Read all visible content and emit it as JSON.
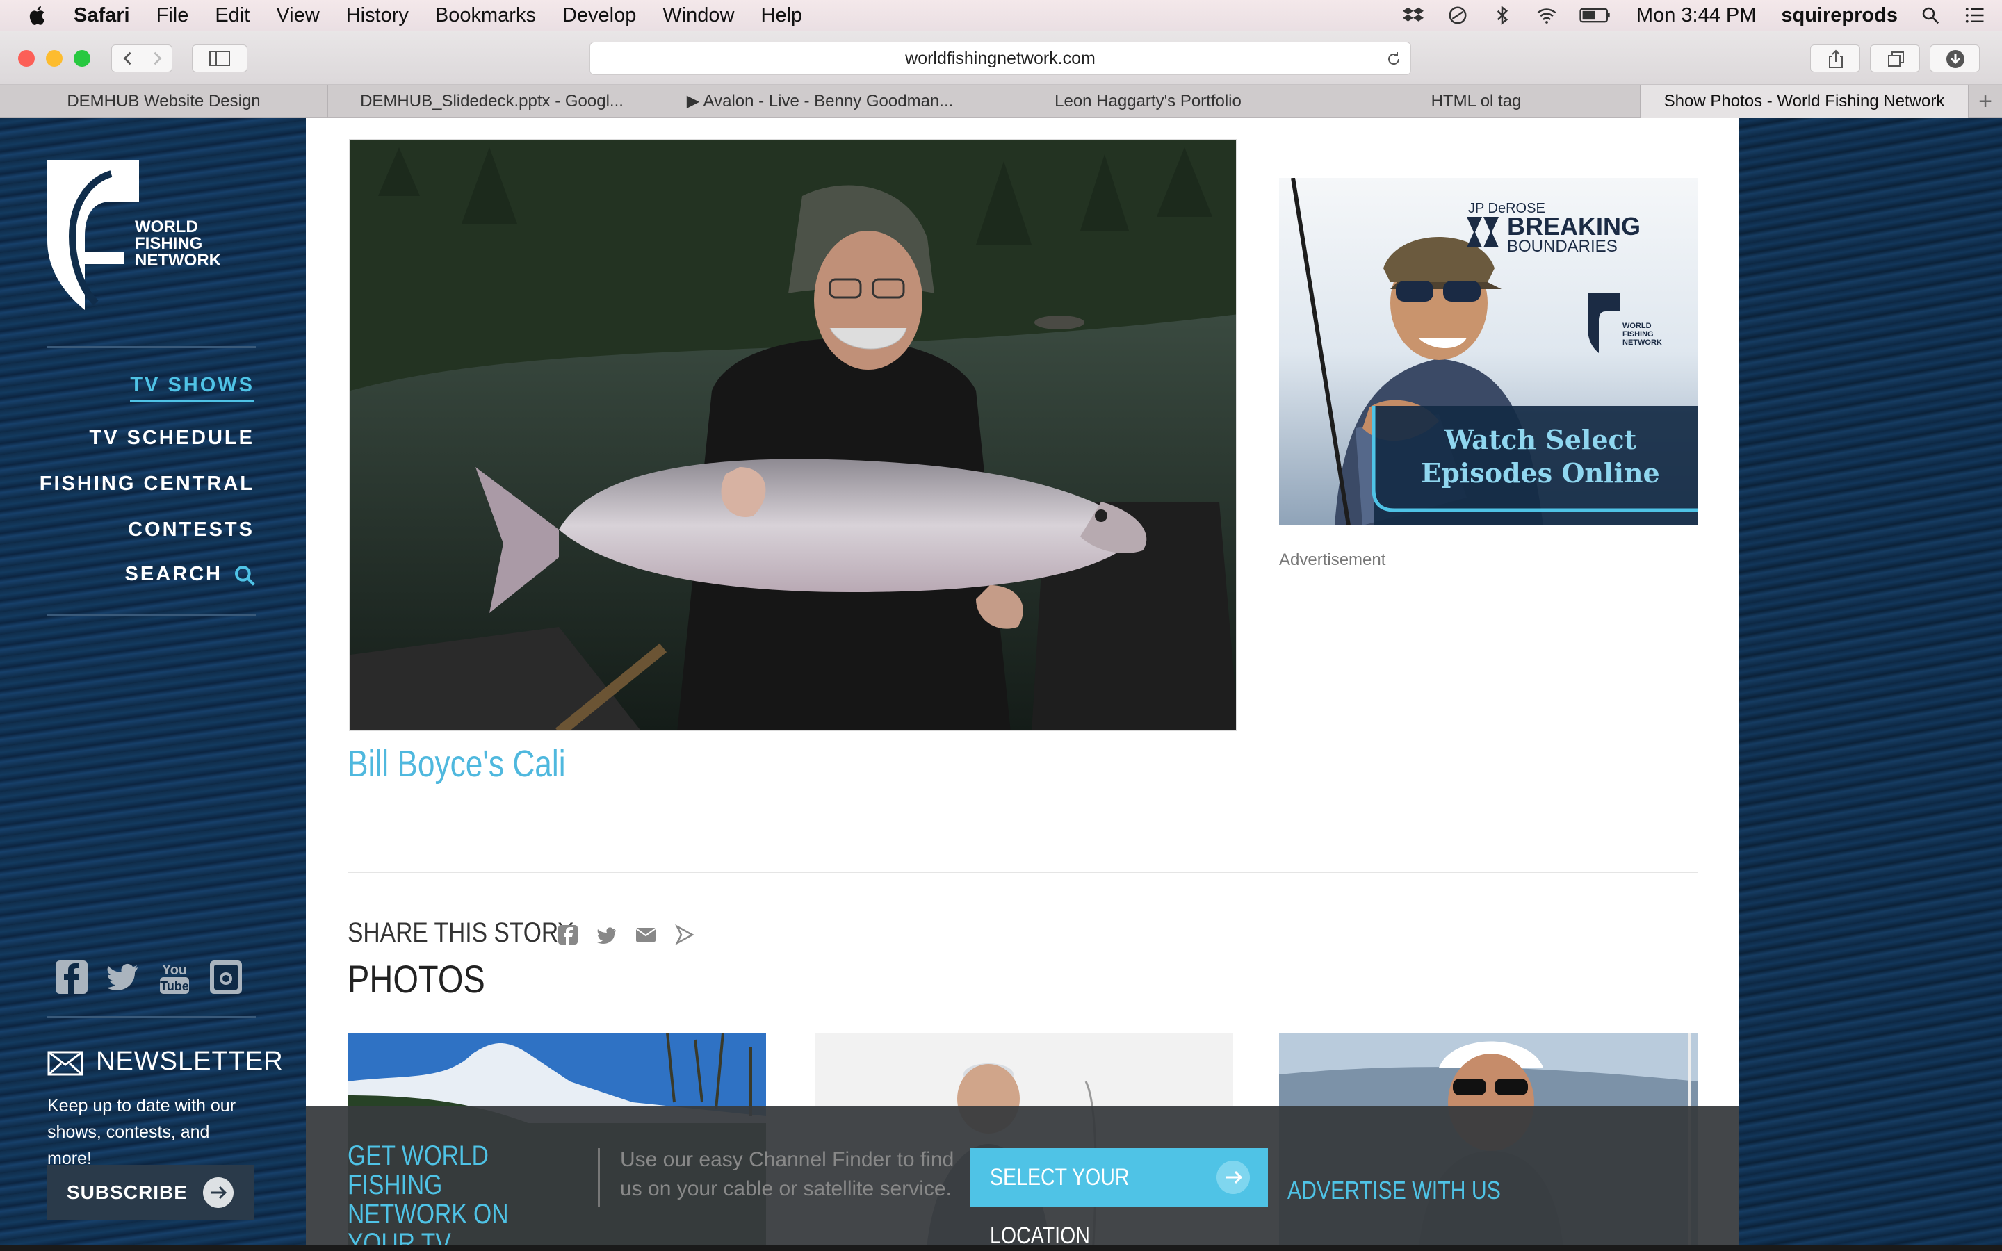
{
  "menubar": {
    "items": [
      "Safari",
      "File",
      "Edit",
      "View",
      "History",
      "Bookmarks",
      "Develop",
      "Window",
      "Help"
    ],
    "clock": "Mon 3:44 PM",
    "user": "squireprods"
  },
  "browser": {
    "url": "worldfishingnetwork.com",
    "tabs": [
      {
        "label": "DEMHUB Website Design"
      },
      {
        "label": "DEMHUB_Slidedeck.pptx - Googl..."
      },
      {
        "label": "▶ Avalon - Live - Benny Goodman..."
      },
      {
        "label": "Leon Haggarty's Portfolio"
      },
      {
        "label": "HTML ol tag"
      },
      {
        "label": "Show Photos - World Fishing Network"
      }
    ],
    "new_tab": "+"
  },
  "sidebar": {
    "logo_text": [
      "WORLD",
      "FISHING",
      "NETWORK"
    ],
    "nav": [
      "TV SHOWS",
      "TV SCHEDULE",
      "FISHING CENTRAL",
      "CONTESTS",
      "SEARCH"
    ],
    "newsletter_title": "NEWSLETTER",
    "newsletter_text": "Keep up to date with our shows, contests, and more!",
    "subscribe_label": "SUBSCRIBE"
  },
  "main": {
    "caption": "Bill Boyce's Cali",
    "ad": {
      "brand_small": "JP DeROSE",
      "brand_line1": "BREAKING",
      "brand_line2": "BOUNDARIES",
      "network": [
        "WORLD",
        "FISHING",
        "NETWORK"
      ],
      "cta_line1": "Watch Select",
      "cta_line2": "Episodes Online"
    },
    "ad_label": "Advertisement",
    "share_label": "SHARE THIS STORY",
    "photos_title": "PHOTOS"
  },
  "promo": {
    "title": "GET WORLD FISHING NETWORK ON YOUR TV",
    "text": "Use our easy Channel Finder to find us on your cable or satellite service.",
    "button": "SELECT YOUR LOCATION",
    "advertise": "ADVERTISE WITH US"
  },
  "colors": {
    "accent": "#4fc3e6",
    "sidebar_bg": "#102d4b",
    "promo_bg": "#373a3e"
  }
}
